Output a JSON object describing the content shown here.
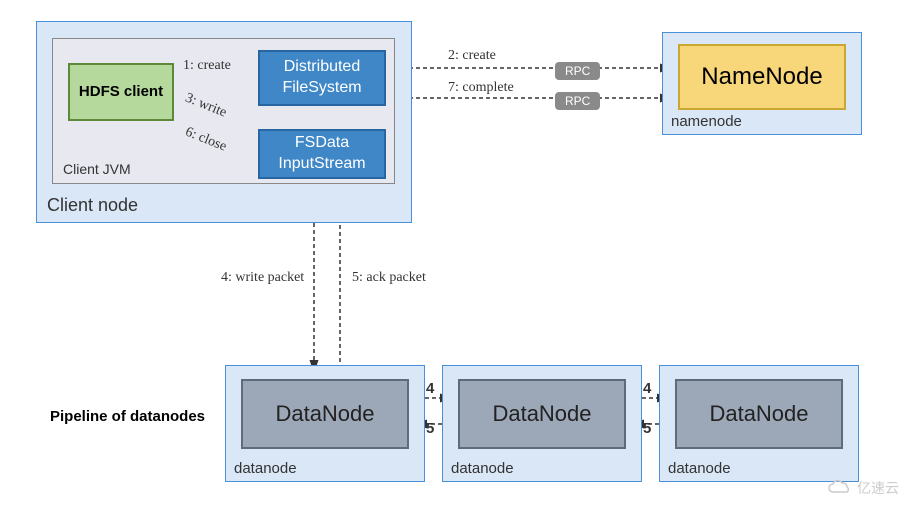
{
  "client_node": {
    "label": "Client node"
  },
  "client_jvm": {
    "label": "Client JVM"
  },
  "hdfs_client": {
    "label": "HDFS client"
  },
  "dist_fs": {
    "label": "Distributed FileSystem"
  },
  "fsdata": {
    "label": "FSData InputStream"
  },
  "namenode_outer": {
    "label": "namenode"
  },
  "namenode_box": {
    "label": "NameNode"
  },
  "datanode_outer": {
    "label": "datanode"
  },
  "datanode_box": {
    "label": "DataNode"
  },
  "edges": {
    "e1": "1: create",
    "e2": "2: create",
    "e3": "3: write",
    "e4": "4: write packet",
    "e5": "5: ack packet",
    "e6": "6: close",
    "e7": "7: complete",
    "n4": "4",
    "n5": "5"
  },
  "rpc": {
    "label": "RPC"
  },
  "pipeline": {
    "label": "Pipeline of datanodes"
  },
  "watermark": {
    "text": "亿速云"
  }
}
